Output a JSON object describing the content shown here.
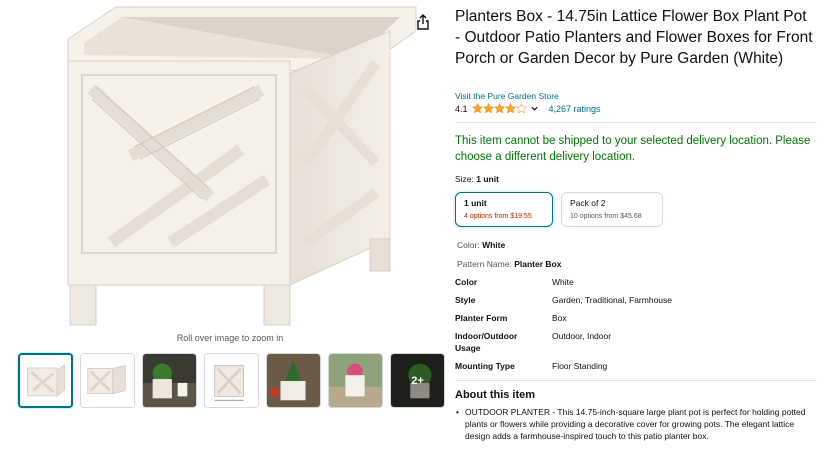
{
  "product": {
    "title": "Planters Box - 14.75in Lattice Flower Box Plant Pot - Outdoor Patio Planters and Flower Boxes for Front Porch or Garden Decor by Pure Garden (White)",
    "store_link": "Visit the Pure Garden Store",
    "rating_value": "4.1",
    "rating_stars": 4.1,
    "ratings_count": "4,267 ratings"
  },
  "gallery": {
    "zoom_hint": "Roll over image to zoom in",
    "more_label": "2+",
    "thumbnail_count": 7
  },
  "shipping": {
    "message": "This item cannot be shipped to your selected delivery location. Please choose a different delivery location."
  },
  "size": {
    "label": "Size:",
    "selected": "1 unit",
    "options": [
      {
        "title": "1 unit",
        "subtitle": "4 options from $19.55"
      },
      {
        "title": "Pack of 2",
        "subtitle": "10 options from $45.68"
      }
    ]
  },
  "attributes": {
    "color_label": "Color:",
    "color_value": "White",
    "pattern_label": "Pattern Name:",
    "pattern_value": "Planter Box"
  },
  "specs": [
    {
      "key": "Color",
      "value": "White"
    },
    {
      "key": "Style",
      "value": "Garden, Traditional, Farmhouse"
    },
    {
      "key": "Planter Form",
      "value": "Box"
    },
    {
      "key": "Indoor/Outdoor Usage",
      "value": "Outdoor, Indoor"
    },
    {
      "key": "Mounting Type",
      "value": "Floor Standing"
    }
  ],
  "about": {
    "heading": "About this item",
    "bullets": [
      "OUTDOOR PLANTER - This 14.75-inch-square large plant pot is perfect for holding potted plants or flowers while providing a decorative cover for growing pots. The elegant lattice design adds a farmhouse-inspired touch to this patio planter box."
    ]
  },
  "colors": {
    "link": "#007185",
    "ship_green": "#007600",
    "price_red": "#b12704",
    "star": "#ffa41c",
    "product_white": "#f4f0ea"
  },
  "icons": [
    "share-icon",
    "star-icon",
    "chevron-down-icon"
  ]
}
